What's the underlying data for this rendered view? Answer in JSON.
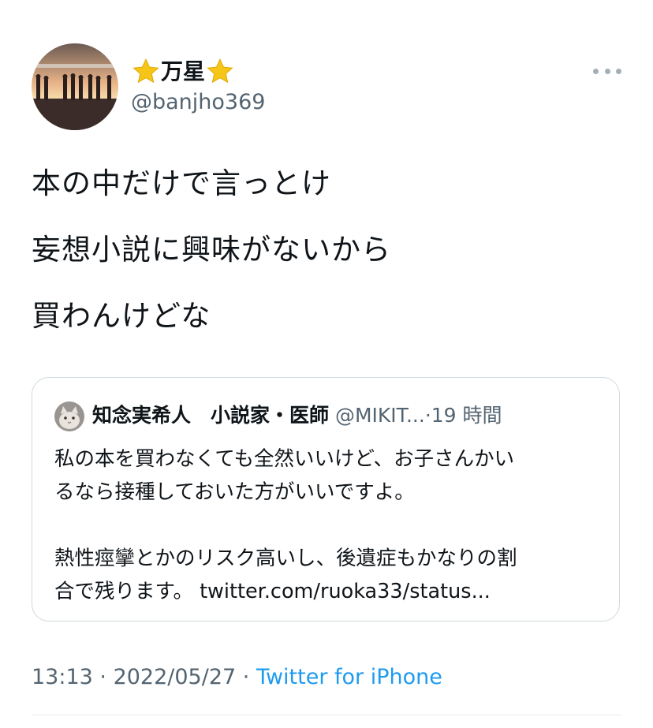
{
  "author": {
    "avatar_icon": "sunset-group-photo",
    "name_prefix_icon": "star-icon",
    "name": "万星",
    "name_suffix_icon": "star-icon",
    "handle": "@banjho369"
  },
  "menu_icon": "more-horizontal-icon",
  "tweet": {
    "lines": [
      "本の中だけで言っとけ",
      "妄想小説に興味がないから",
      "買わんけどな"
    ]
  },
  "quote": {
    "avatar_icon": "cat-avatar",
    "name": "知念実希人　小説家・医師",
    "handle": "@MIKIT...",
    "separator": "·",
    "time": "19 時間",
    "lines": [
      "私の本を買わなくても全然いいけど、お子さんかい",
      "るなら接種しておいた方がいいですよ。",
      "熱性痙攣とかのリスク高いし、後遺症もかなりの割",
      "合で残ります。"
    ],
    "link": "twitter.com/ruoka33/status..."
  },
  "footer": {
    "time": "13:13",
    "sep1": " · ",
    "date": "2022/05/27",
    "sep2": " · ",
    "source": "Twitter for iPhone"
  },
  "colors": {
    "text": "#0f1419",
    "secondary": "#536471",
    "link": "#1d9bf0",
    "border": "#cfd9de",
    "star": "#f5c518"
  }
}
